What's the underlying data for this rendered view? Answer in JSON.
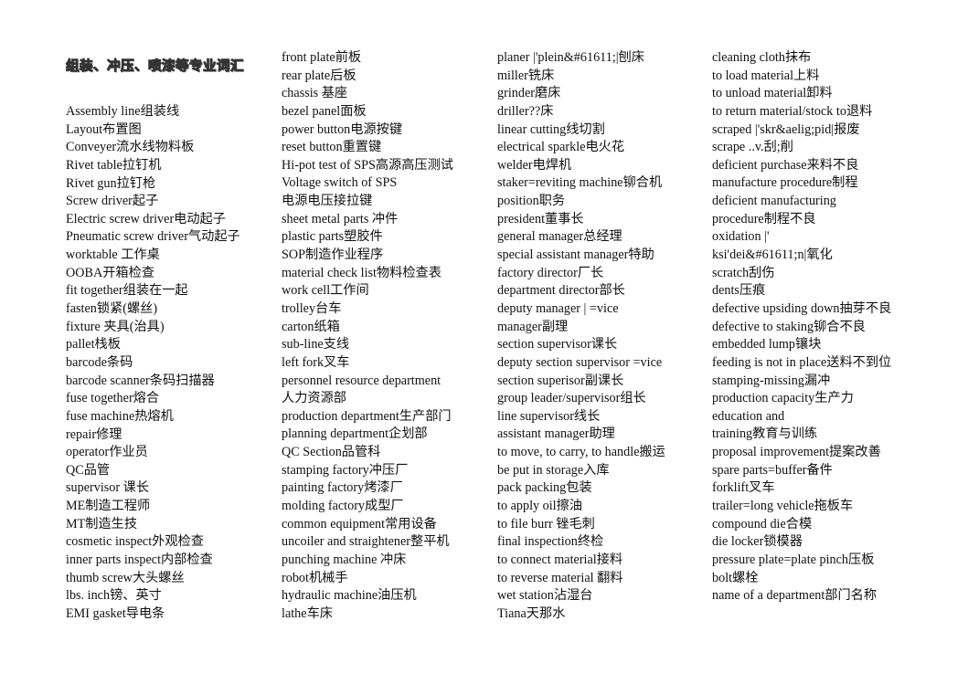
{
  "document": {
    "title": "组装、冲压、喷漆等专业词汇",
    "columns": [
      {
        "entries": [
          "Assembly line组装线",
          "Layout布置图",
          "Conveyer流水线物料板",
          "Rivet table拉钉机",
          "Rivet gun拉钉枪",
          "Screw driver起子",
          "Electric screw driver电动起子",
          "Pneumatic screw driver气动起子",
          "worktable 工作桌",
          "OOBA开箱检查",
          "fit together组装在一起",
          "fasten锁紧(螺丝)",
          "fixture 夹具(治具)",
          "pallet栈板",
          "barcode条码",
          "barcode scanner条码扫描器",
          "fuse together熔合",
          "fuse machine热熔机",
          "repair修理",
          "operator作业员",
          "QC品管",
          "supervisor 课长",
          "ME制造工程师",
          "MT制造生技",
          "cosmetic inspect外观检查",
          "inner parts inspect内部检查",
          "thumb screw大头螺丝",
          "lbs. inch镑、英寸",
          "EMI gasket导电条"
        ]
      },
      {
        "entries": [
          "front plate前板",
          "rear plate后板",
          "chassis  基座",
          "bezel panel面板",
          "power button电源按键",
          "reset button重置键",
          "Hi-pot test of SPS高源高压测试",
          "Voltage switch of SPS",
          "电源电压接拉键",
          "sheet metal parts 冲件",
          "plastic parts塑胶件",
          "SOP制造作业程序",
          "material check list物料检查表",
          "work cell工作间",
          "trolley台车",
          "carton纸箱",
          "sub-line支线",
          "left fork叉车",
          "personnel resource department",
          "人力资源部",
          "production department生产部门",
          "planning department企划部",
          "QC Section品管科",
          "stamping factory冲压厂",
          "painting factory烤漆厂",
          "molding factory成型厂",
          "common equipment常用设备",
          "uncoiler and straightener整平机",
          "punching machine 冲床",
          "robot机械手",
          "hydraulic machine油压机",
          "lathe车床"
        ]
      },
      {
        "entries": [
          "planer |'plein&#61611;|刨床",
          "miller铣床",
          "grinder磨床",
          "driller??床",
          "linear cutting线切割",
          "electrical sparkle电火花",
          "welder电焊机",
          "staker=reviting machine铆合机",
          "position职务",
          "president董事长",
          "general manager总经理",
          "special assistant manager特助",
          "factory director厂长",
          "department director部长",
          "deputy manager | =vice",
          "manager副理",
          "section supervisor课长",
          "deputy section supervisor =vice",
          "section superisor副课长",
          "group leader/supervisor组长",
          "line supervisor线长",
          "assistant manager助理",
          "to move, to carry, to handle搬运",
          "be put in storage入库",
          "pack packing包装",
          "to apply oil擦油",
          "to file burr 锉毛刺",
          "final inspection终检",
          "to connect material接料",
          "to reverse material 翻料",
          "wet station沾湿台",
          "Tiana天那水"
        ]
      },
      {
        "entries": [
          "cleaning cloth抹布",
          "to load material上料",
          "to unload material卸料",
          "to return material/stock to退料",
          "scraped |'skr&aelig;pid|报废",
          "scrape ..v.刮;削",
          "deficient purchase来料不良",
          "manufacture procedure制程",
          "deficient manufacturing",
          "procedure制程不良",
          "oxidation |'",
          "ksi'dei&#61611;n|氧化",
          "scratch刮伤",
          "dents压痕",
          "defective upsiding down抽芽不良",
          "defective to staking铆合不良",
          "embedded lump镶块",
          "feeding is not in place送料不到位",
          "stamping-missing漏冲",
          "production capacity生产力",
          "education and",
          "training教育与训练",
          "proposal improvement提案改善",
          "spare parts=buffer备件",
          "forklift叉车",
          "trailer=long vehicle拖板车",
          "compound die合模",
          "die locker锁模器",
          "pressure plate=plate pinch压板",
          "bolt螺栓",
          "name of a department部门名称"
        ]
      }
    ]
  }
}
